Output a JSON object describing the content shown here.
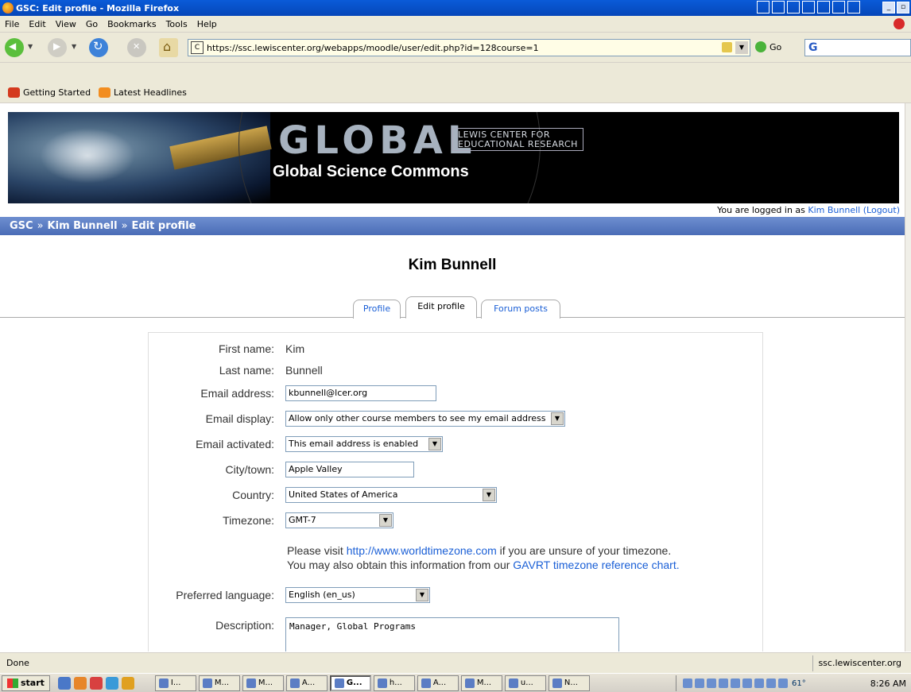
{
  "window": {
    "title": "GSC: Edit profile - Mozilla Firefox"
  },
  "menubar": {
    "items": [
      "File",
      "Edit",
      "View",
      "Go",
      "Bookmarks",
      "Tools",
      "Help"
    ]
  },
  "nav": {
    "url": "https://ssc.lewiscenter.org/webapps/moodle/user/edit.php?id=128course=1",
    "go_label": "Go",
    "site_icon": "C",
    "search_icon": "G"
  },
  "bookmarks": [
    {
      "label": "Getting Started",
      "icon": "firefox-icon"
    },
    {
      "label": "Latest Headlines",
      "icon": "rss-icon"
    }
  ],
  "banner": {
    "word": "GLOBAL",
    "lcer_line1": "LEWIS CENTER FOR",
    "lcer_line2": "EDUCATIONAL RESEARCH",
    "subtitle": "Global Science Commons"
  },
  "login": {
    "prefix": "You are logged in as",
    "user": "Kim Bunnell",
    "logout_open": "(",
    "logout": "Logout",
    "logout_close": ")"
  },
  "breadcrumb": {
    "items": [
      "GSC",
      "Kim Bunnell",
      "Edit profile"
    ],
    "sep": "»"
  },
  "page_title": "Kim Bunnell",
  "tabs": [
    {
      "label": "Profile",
      "active": false
    },
    {
      "label": "Edit profile",
      "active": true
    },
    {
      "label": "Forum posts",
      "active": false
    }
  ],
  "form": {
    "first_name": {
      "label": "First name:",
      "value": "Kim"
    },
    "last_name": {
      "label": "Last name:",
      "value": "Bunnell"
    },
    "email": {
      "label": "Email address:",
      "value": "kbunnell@lcer.org"
    },
    "email_display": {
      "label": "Email display:",
      "value": "Allow only other course members to see my email address"
    },
    "email_activated": {
      "label": "Email activated:",
      "value": "This email address is enabled"
    },
    "city": {
      "label": "City/town:",
      "value": "Apple Valley"
    },
    "country": {
      "label": "Country:",
      "value": "United States of America"
    },
    "timezone": {
      "label": "Timezone:",
      "value": "GMT-7",
      "note1_pre": "Please visit",
      "note1_link": "http://www.worldtimezone.com",
      "note1_post": "if you are unsure of your timezone.",
      "note2_pre": "You may also obtain this information from our",
      "note2_link": "GAVRT timezone reference chart."
    },
    "language": {
      "label": "Preferred language:",
      "value": "English (en_us)"
    },
    "description": {
      "label": "Description:",
      "value": "Manager, Global Programs"
    }
  },
  "status": {
    "text": "Done",
    "host": "ssc.lewiscenter.org"
  },
  "taskbar": {
    "start": "start",
    "tasks": [
      "I...",
      "M...",
      "M...",
      "A...",
      "G...",
      "h...",
      "A...",
      "M...",
      "u...",
      "N..."
    ],
    "temperature": "61°",
    "clock": "8:26 AM"
  }
}
